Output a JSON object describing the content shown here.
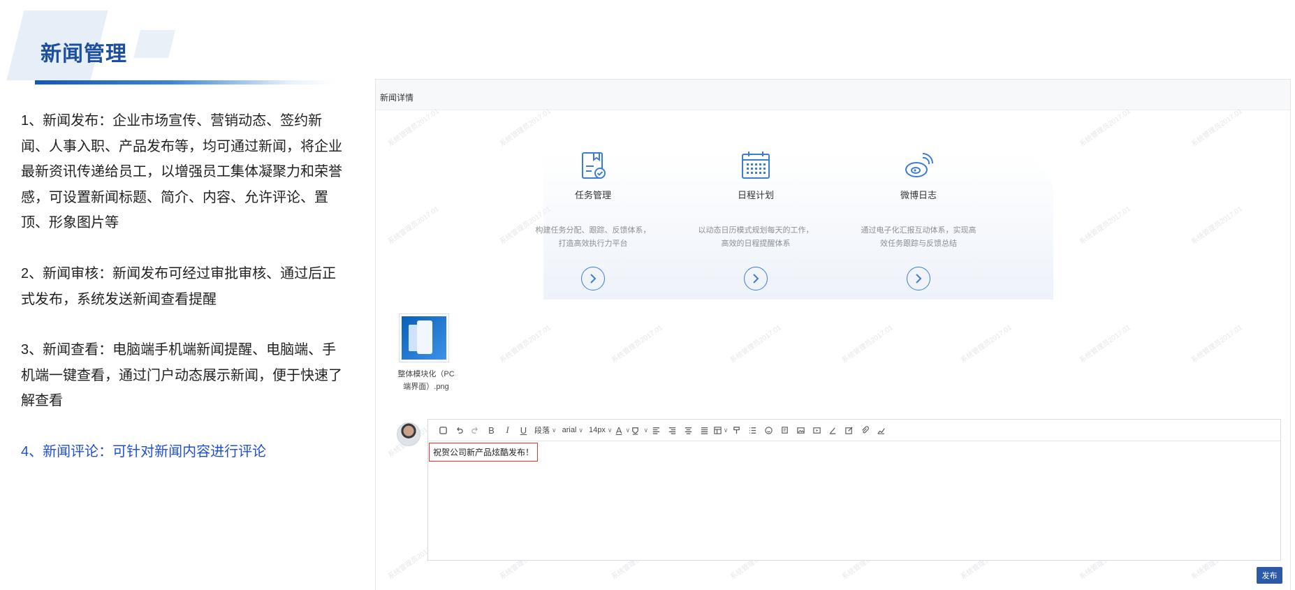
{
  "header": {
    "title": "新闻管理"
  },
  "descriptions": [
    "1、新闻发布：企业市场宣传、营销动态、签约新闻、人事入职、产品发布等，均可通过新闻，将企业最新资讯传递给员工，以增强员工集体凝聚力和荣誉感，可设置新闻标题、简介、内容、允许评论、置顶、形象图片等",
    "2、新闻审核：新闻发布可经过审批审核、通过后正式发布，系统发送新闻查看提醒",
    "3、新闻查看：电脑端手机端新闻提醒、电脑端、手机端一键查看，通过门户动态展示新闻，便于快速了解查看",
    "4、新闻评论：可针对新闻内容进行评论"
  ],
  "panel": {
    "title": "新闻详情",
    "watermark": "系统管理员2017.01",
    "features": [
      {
        "name": "任务管理",
        "desc_line1": "构建任务分配、跟踪、反馈体系，",
        "desc_line2": "打造高效执行力平台",
        "icon": "task-icon"
      },
      {
        "name": "日程计划",
        "desc_line1": "以动态日历模式规划每天的工作，",
        "desc_line2": "高效的日程提醒体系",
        "icon": "calendar-icon"
      },
      {
        "name": "微博日志",
        "desc_line1": "通过电子化汇报互动体系，实现高",
        "desc_line2": "效任务跟踪与反馈总结",
        "icon": "weibo-icon"
      }
    ],
    "attachment": {
      "name_line1": "整体模块化（PC",
      "name_line2": "端界面）.png"
    },
    "editor": {
      "paragraph_select": "段落",
      "font_select": "arial",
      "size_select": "14px",
      "content": "祝贺公司新产品炫酷发布！"
    },
    "publish_label": "发布",
    "accent_color": "#3a7cd6",
    "button_color": "#2c59a8"
  }
}
